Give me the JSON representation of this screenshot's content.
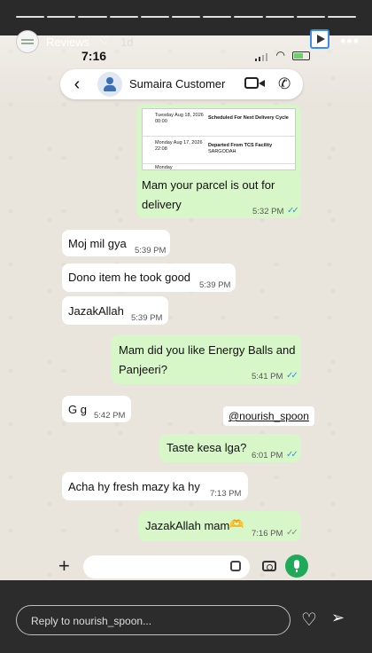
{
  "story": {
    "username": "Reviews",
    "age": "1d",
    "reply_placeholder": "Reply to nourish_spoon..."
  },
  "phone": {
    "clock": "7:16"
  },
  "chat": {
    "contact_name": "Sumaira Customer",
    "mention": "@nourish_spoon",
    "receipt": {
      "rows": [
        {
          "date": "Tuesday Aug 18, 2026 00:00",
          "event": "Scheduled For Next Delivery Cycle",
          "sub": ""
        },
        {
          "date": "Monday Aug 17, 2026 22:08",
          "event": "Departed From TCS Facility",
          "sub": "SARGODAH"
        },
        {
          "date": "Monday",
          "event": "",
          "sub": ""
        }
      ]
    },
    "messages": [
      {
        "id": "m1",
        "dir": "out",
        "text_lines": [
          "Mam your parcel is out for",
          "delivery"
        ],
        "time": "5:32 PM"
      },
      {
        "id": "m2",
        "dir": "in",
        "text": "Moj mil gya",
        "time": "5:39 PM"
      },
      {
        "id": "m3",
        "dir": "in",
        "text": "Dono item he took good",
        "time": "5:39 PM"
      },
      {
        "id": "m4",
        "dir": "in",
        "text": "JazakAllah",
        "time": "5:39 PM"
      },
      {
        "id": "m5",
        "dir": "out",
        "text_lines": [
          "Mam did you like Energy Balls and",
          "Panjeeri?"
        ],
        "time": "5:41 PM"
      },
      {
        "id": "m6",
        "dir": "in",
        "text": "G g",
        "time": "5:42 PM"
      },
      {
        "id": "m7",
        "dir": "out",
        "text": "Taste kesa lga?",
        "time": "6:01 PM"
      },
      {
        "id": "m8",
        "dir": "in",
        "text": "Acha hy fresh  mazy ka hy",
        "time": "7:13 PM"
      },
      {
        "id": "m9",
        "dir": "out",
        "text": "JazakAllah mam",
        "emoji": "🫶",
        "time": "7:16 PM"
      }
    ]
  },
  "colors": {
    "outgoing_bubble": "#d8f7c8",
    "incoming_bubble": "#ffffff",
    "read_ticks": "#3a8fd9",
    "mic_button": "#1faa5a"
  }
}
